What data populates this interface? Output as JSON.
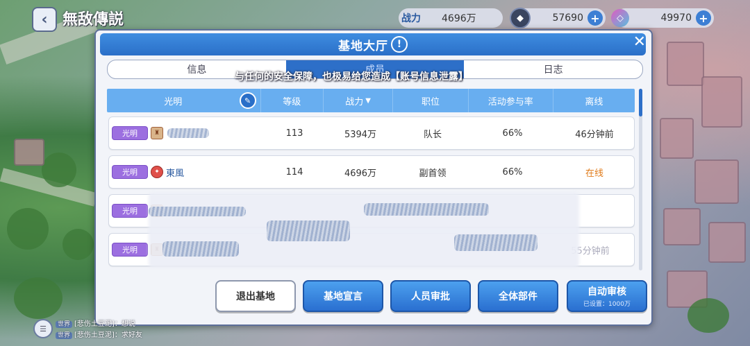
{
  "top_bar": {
    "back_icon": "back-arrow-icon",
    "game_title": "無敌傳説",
    "power_label": "战力",
    "power_value": "4696万",
    "resource1_value": "57690",
    "resource2_value": "49970"
  },
  "dialog": {
    "title": "基地大厅",
    "tabs": [
      {
        "label": "信息",
        "active": false
      },
      {
        "label": "成员",
        "active": true
      },
      {
        "label": "日志",
        "active": false
      }
    ],
    "marquee": "与任何的安全保障，也极易给您造成【账号信息泄露】",
    "columns": {
      "name": "光明",
      "level": "等级",
      "power": "战力",
      "position": "职位",
      "activity": "活动参与率",
      "offline": "离线"
    },
    "rows": [
      {
        "faction": "光明",
        "name": "",
        "level": "113",
        "power": "5394万",
        "position": "队长",
        "activity": "66%",
        "offline": "46分钟前"
      },
      {
        "faction": "光明",
        "name": "東風",
        "level": "114",
        "power": "4696万",
        "position": "副首领",
        "activity": "66%",
        "offline": "在线"
      },
      {
        "faction": "光明",
        "name": "",
        "level": "",
        "power": "",
        "position": "",
        "activity": "",
        "offline": ""
      },
      {
        "faction": "光明",
        "name": "",
        "level": "",
        "power": "",
        "position": "",
        "activity": "",
        "offline": "55分钟前"
      }
    ],
    "buttons": {
      "leave": "退出基地",
      "declaration": "基地宣言",
      "approve": "人员审批",
      "mail": "全体部件",
      "auto_approve": "自动审核",
      "auto_approve_sub": "已设置：1000万"
    }
  },
  "chat": {
    "lines": [
      {
        "channel": "世界",
        "text": "[悲伤土豆泥]：想说"
      },
      {
        "channel": "世界",
        "text": "[悲伤土豆泥]：求好友"
      }
    ]
  },
  "colors": {
    "accent": "#2d6fc8",
    "header_blue": "#68aef0",
    "faction_purple": "#9c6fe0",
    "online_orange": "#e07b1a"
  }
}
